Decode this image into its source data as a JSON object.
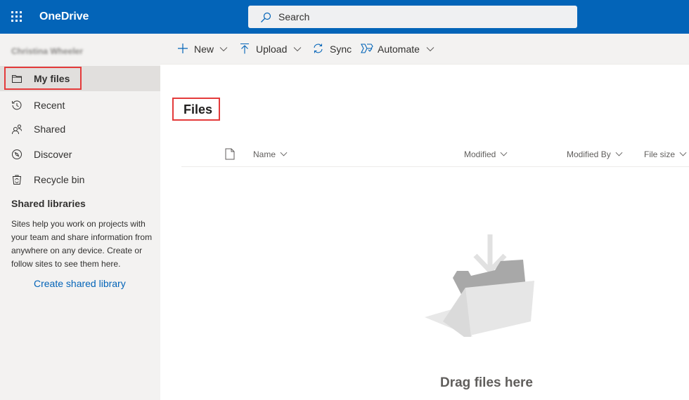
{
  "app": {
    "name": "OneDrive",
    "search_placeholder": "Search",
    "brand_color": "#0364b8"
  },
  "sidebar": {
    "user_name": "Christina Wheeler",
    "items": [
      {
        "label": "My files",
        "icon": "folder-icon",
        "active": true
      },
      {
        "label": "Recent",
        "icon": "history-icon"
      },
      {
        "label": "Shared",
        "icon": "people-icon"
      },
      {
        "label": "Discover",
        "icon": "compass-icon"
      },
      {
        "label": "Recycle bin",
        "icon": "recycle-bin-icon"
      }
    ],
    "shared_libraries": {
      "title": "Shared libraries",
      "description": "Sites help you work on projects with your team and share information from anywhere on any device. Create or follow sites to see them here.",
      "create_link": "Create shared library"
    }
  },
  "toolbar": {
    "new_label": "New",
    "upload_label": "Upload",
    "sync_label": "Sync",
    "automate_label": "Automate"
  },
  "main": {
    "title": "Files",
    "columns": {
      "name": "Name",
      "modified": "Modified",
      "modified_by": "Modified By",
      "file_size": "File size"
    },
    "empty_message": "Drag files here"
  },
  "highlight_color": "#e43b3b"
}
